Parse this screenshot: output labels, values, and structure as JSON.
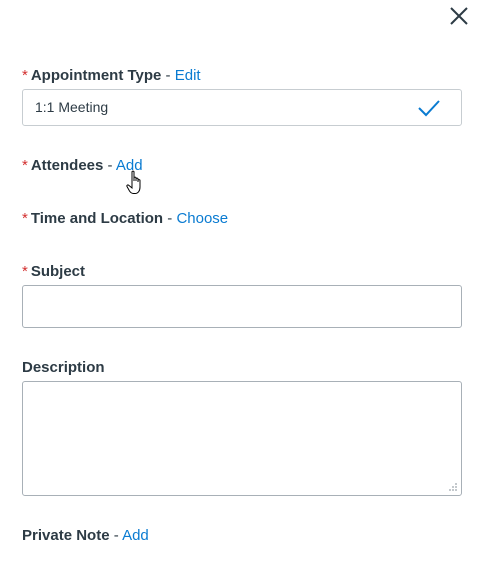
{
  "dialog": {
    "close_icon": "close-icon"
  },
  "appointment_type": {
    "required_marker": "*",
    "label": "Appointment Type",
    "separator": " - ",
    "action": "Edit",
    "selected_value": "1:1 Meeting",
    "selected_icon": "check-icon"
  },
  "attendees": {
    "required_marker": "*",
    "label": "Attendees",
    "separator": " - ",
    "action": "Add"
  },
  "time_location": {
    "required_marker": "*",
    "label": "Time and Location",
    "separator": " - ",
    "action": "Choose"
  },
  "subject": {
    "required_marker": "*",
    "label": "Subject",
    "value": ""
  },
  "description": {
    "label": "Description",
    "value": ""
  },
  "private_note": {
    "label": "Private Note",
    "separator": " - ",
    "action": "Add"
  },
  "colors": {
    "link": "#0a7bd1",
    "required": "#d32f2f",
    "text": "#2d3b45"
  }
}
